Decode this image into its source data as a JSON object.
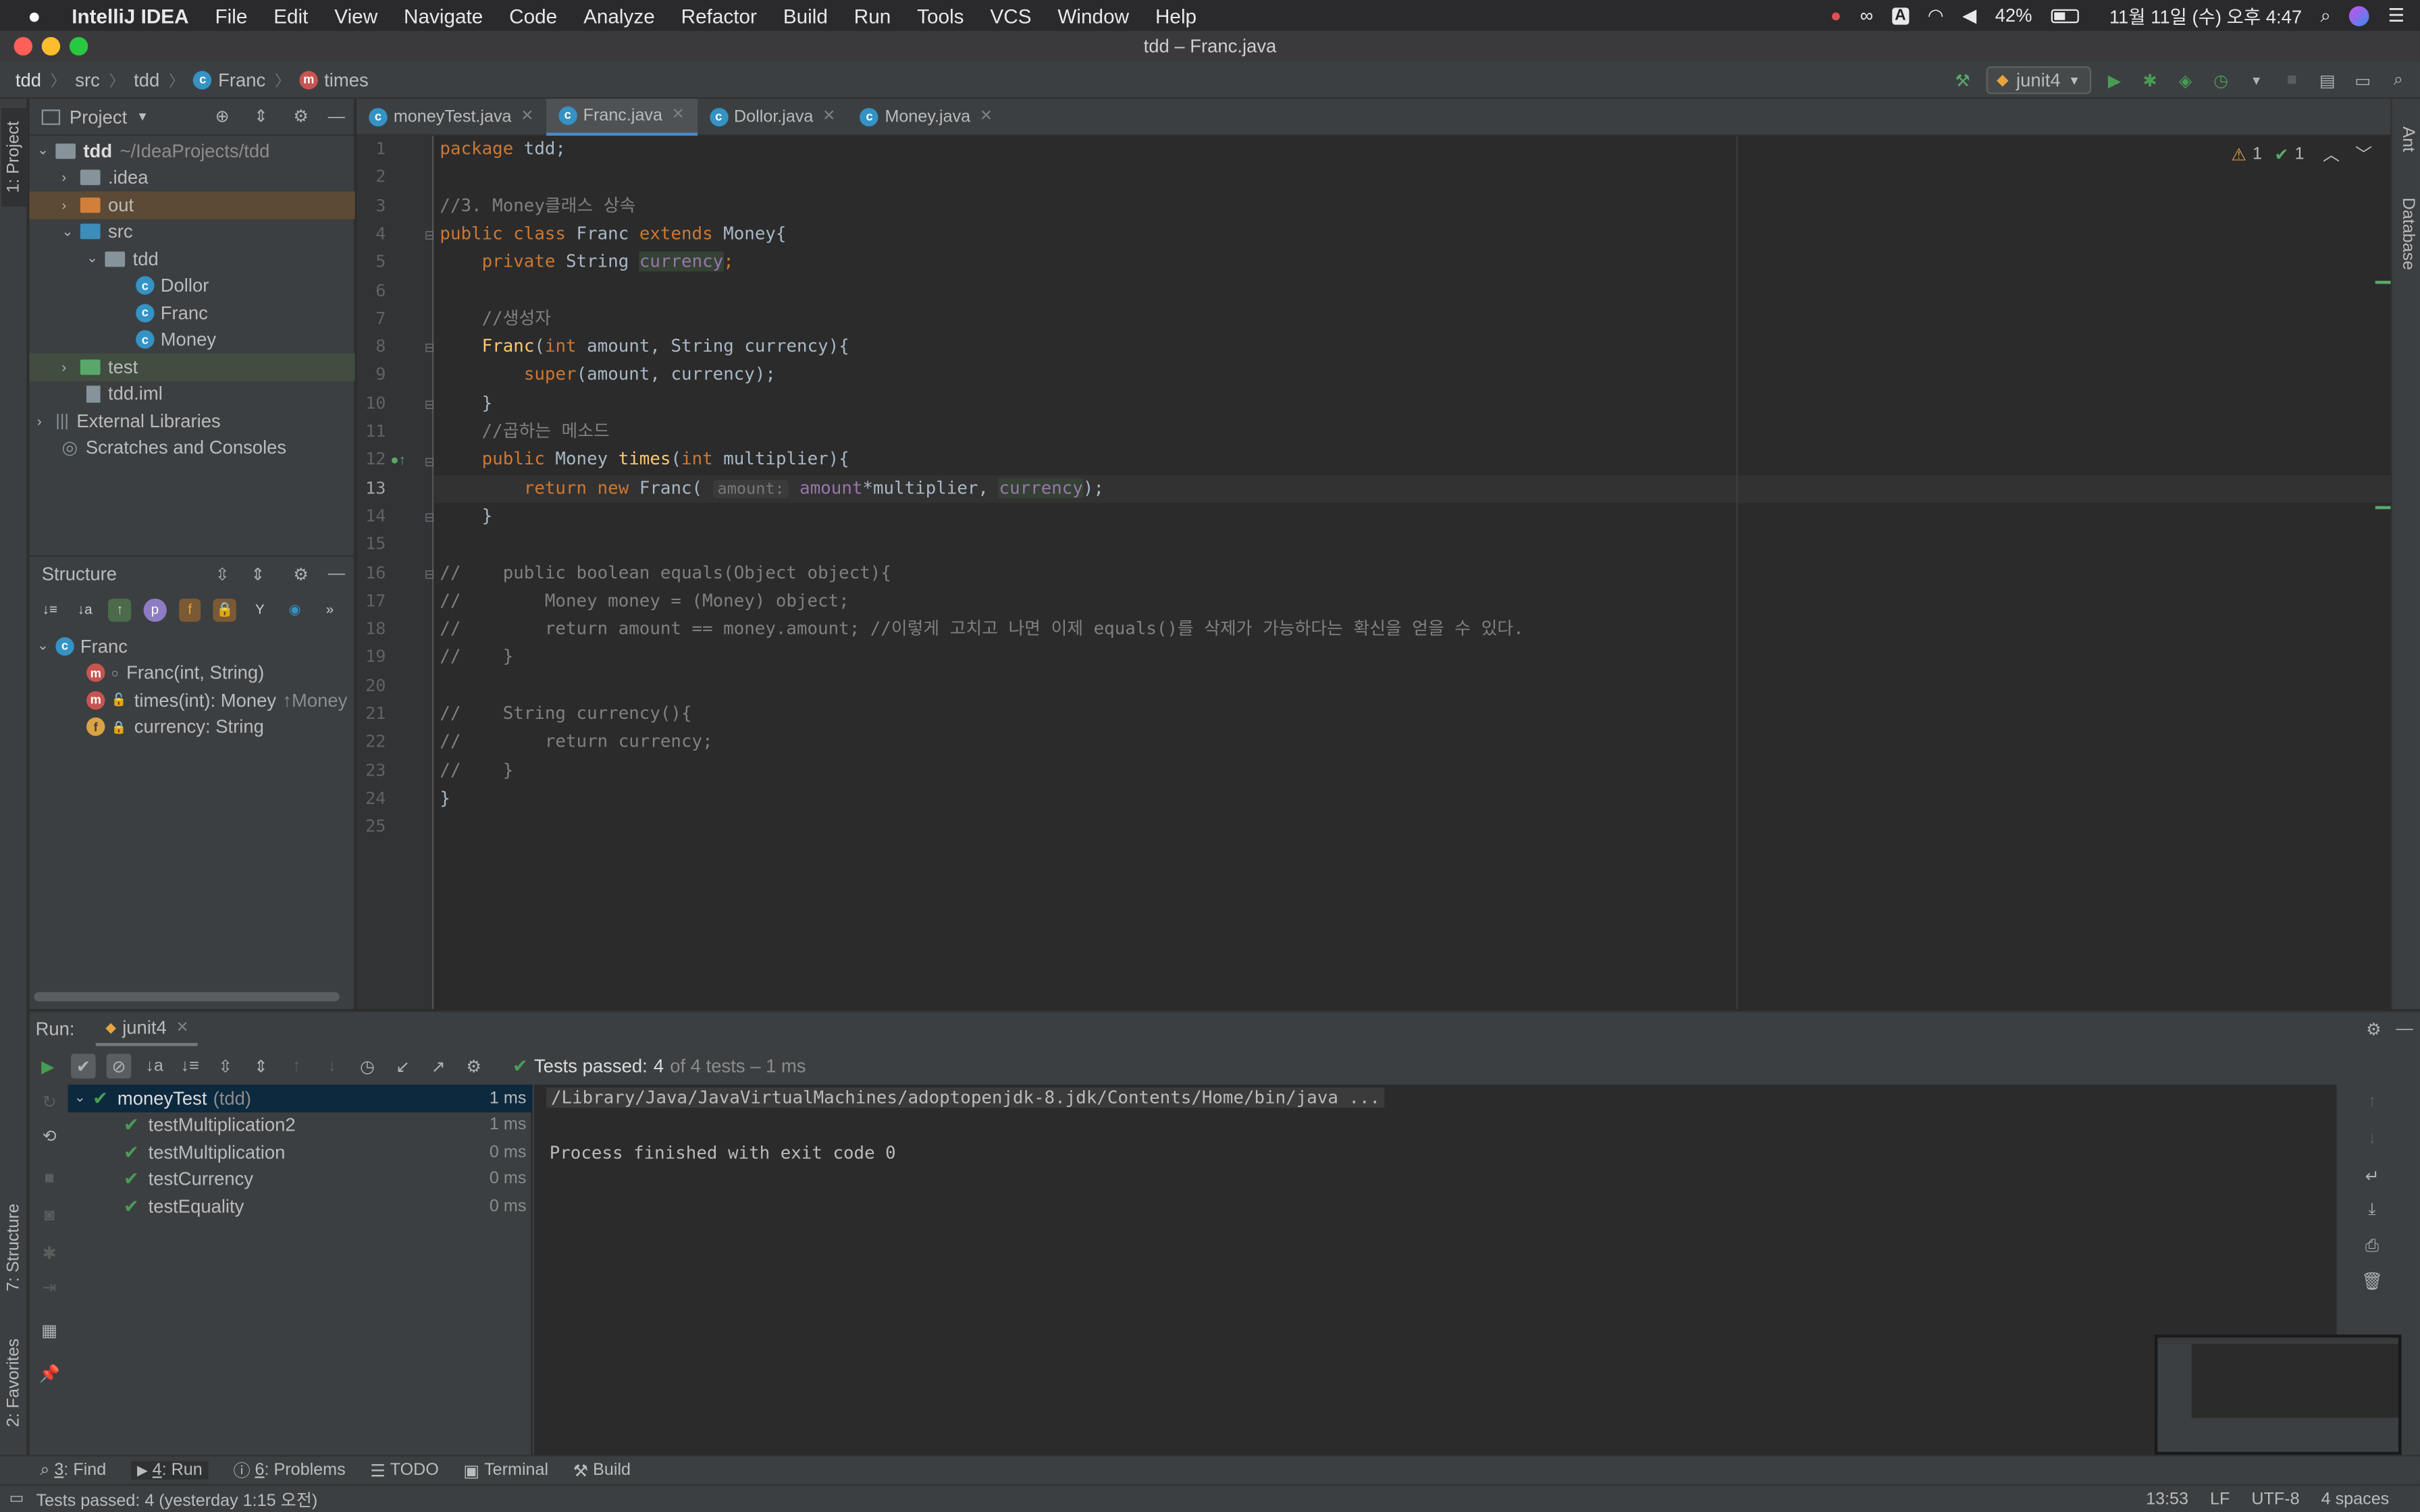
{
  "menubar": {
    "app": "IntelliJ IDEA",
    "items": [
      "File",
      "Edit",
      "View",
      "Navigate",
      "Code",
      "Analyze",
      "Refactor",
      "Build",
      "Run",
      "Tools",
      "VCS",
      "Window",
      "Help"
    ],
    "battery": "42%",
    "datetime": "11월 11일 (수) 오후 4:47",
    "input_letter": "A"
  },
  "window": {
    "title": "tdd – Franc.java"
  },
  "breadcrumb": {
    "items": [
      "tdd",
      "src",
      "tdd",
      "Franc",
      "times"
    ]
  },
  "run_config": {
    "name": "junit4"
  },
  "project": {
    "title": "Project",
    "tree": [
      {
        "label": "tdd",
        "suffix": "~/IdeaProjects/tdd"
      },
      {
        "label": ".idea"
      },
      {
        "label": "out"
      },
      {
        "label": "src"
      },
      {
        "label": "tdd"
      },
      {
        "label": "Dollor"
      },
      {
        "label": "Franc"
      },
      {
        "label": "Money"
      },
      {
        "label": "test"
      },
      {
        "label": "tdd.iml"
      },
      {
        "label": "External Libraries"
      },
      {
        "label": "Scratches and Consoles"
      }
    ]
  },
  "structure": {
    "title": "Structure",
    "root": "Franc",
    "members": [
      {
        "label": "Franc(int, String)",
        "extra": ""
      },
      {
        "label": "times(int): Money",
        "extra": "↑Money"
      },
      {
        "label": "currency: String",
        "extra": ""
      }
    ]
  },
  "tabs": [
    "moneyTest.java",
    "Franc.java",
    "Dollor.java",
    "Money.java"
  ],
  "editor": {
    "inspection": {
      "warnings": "1",
      "ok": "1"
    },
    "line_numbers": [
      "1",
      "2",
      "3",
      "4",
      "5",
      "6",
      "7",
      "8",
      "9",
      "10",
      "11",
      "12",
      "13",
      "14",
      "15",
      "16",
      "17",
      "18",
      "19",
      "20",
      "21",
      "22",
      "23",
      "24",
      "25"
    ],
    "code": {
      "l1a": "package",
      "l1b": " tdd;",
      "l3": "//3. Money클래스 상속",
      "l4a": "public class",
      "l4b": " Franc ",
      "l4c": "extends",
      "l4d": " Money{",
      "l5a": "    private",
      "l5b": " String ",
      "l5c": "currency",
      "l5d": ";",
      "l7": "    //생성자",
      "l8a": "    ",
      "l8b": "Franc",
      "l8c": "(",
      "l8d": "int",
      "l8e": " amount, String currency){",
      "l9a": "        ",
      "l9b": "super",
      "l9c": "(amount, currency);",
      "l10": "    }",
      "l11": "    //곱하는 메소드",
      "l12a": "    public",
      "l12b": " Money ",
      "l12c": "times",
      "l12d": "(",
      "l12e": "int",
      "l12f": " multiplier){",
      "l13a": "        return new",
      "l13b": " Franc( ",
      "l13c": "amount:",
      "l13d": " amount",
      "l13e": "*multiplier, ",
      "l13f": "currency",
      "l13g": ");",
      "l14": "    }",
      "l16": "//    public boolean equals(Object object){",
      "l17": "//        Money money = (Money) object;",
      "l18": "//        return amount == money.amount; //이렇게 고치고 나면 이제 equals()를 삭제가 가능하다는 확신을 얻을 수 있다.",
      "l19": "//    }",
      "l21": "//    String currency(){",
      "l22": "//        return currency;",
      "l23": "//    }",
      "l24": "}"
    }
  },
  "run": {
    "label": "Run:",
    "tab": "junit4",
    "status_prefix": "Tests passed:",
    "passed": "4",
    "status_suffix": "of 4 tests – 1 ms",
    "tests": [
      {
        "name": "moneyTest",
        "suite": "(tdd)",
        "time": "1 ms"
      },
      {
        "name": "testMultiplication2",
        "time": "1 ms"
      },
      {
        "name": "testMultiplication",
        "time": "0 ms"
      },
      {
        "name": "testCurrency",
        "time": "0 ms"
      },
      {
        "name": "testEquality",
        "time": "0 ms"
      }
    ],
    "console": [
      "/Library/Java/JavaVirtualMachines/adoptopenjdk-8.jdk/Contents/Home/bin/java ...",
      "Process finished with exit code 0"
    ]
  },
  "toolwindows": [
    {
      "num": "3",
      "label": ": Find"
    },
    {
      "num": "4",
      "label": ": Run"
    },
    {
      "num": "6",
      "label": ": Problems"
    },
    {
      "num": "",
      "label": "TODO"
    },
    {
      "num": "",
      "label": "Terminal"
    },
    {
      "num": "",
      "label": "Build"
    }
  ],
  "side_tabs": {
    "project": "1: Project",
    "structure": "7: Structure",
    "favorites": "2: Favorites",
    "ant": "Ant",
    "database": "Database"
  },
  "status": {
    "message": "Tests passed: 4 (yesterday 1:15 오전)",
    "position": "13:53",
    "line_sep": "LF",
    "encoding": "UTF-8",
    "indent": "4 spaces"
  }
}
